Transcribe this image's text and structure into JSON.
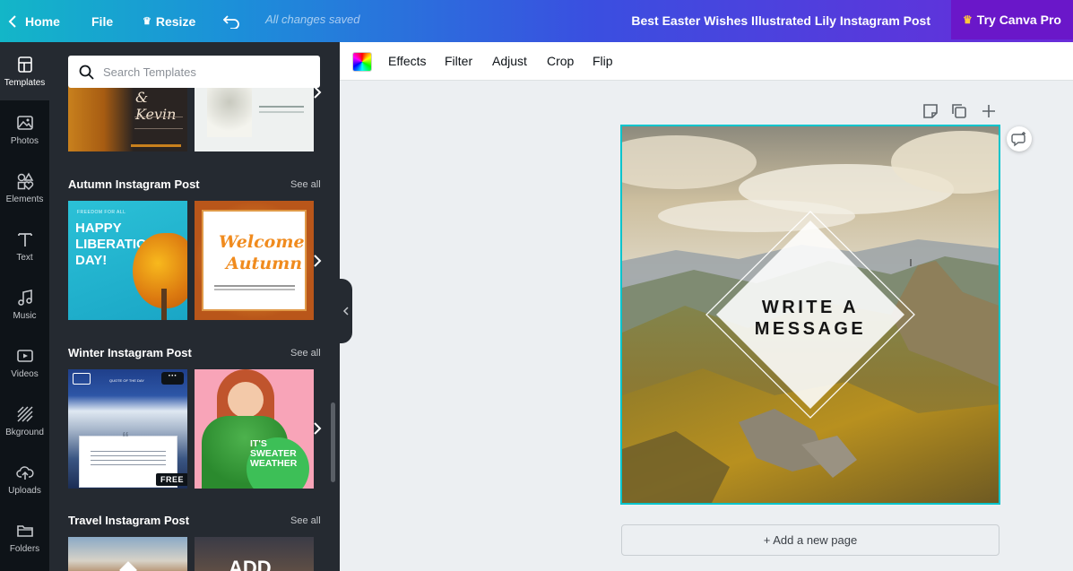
{
  "header": {
    "home_label": "Home",
    "file_label": "File",
    "resize_label": "Resize",
    "saved_status": "All changes saved",
    "doc_title": "Best Easter Wishes Illustrated Lily Instagram Post",
    "pro_label": "Try Canva Pro"
  },
  "rail": {
    "items": [
      {
        "label": "Templates",
        "icon": "templates-icon"
      },
      {
        "label": "Photos",
        "icon": "photos-icon"
      },
      {
        "label": "Elements",
        "icon": "elements-icon"
      },
      {
        "label": "Text",
        "icon": "text-icon"
      },
      {
        "label": "Music",
        "icon": "music-icon"
      },
      {
        "label": "Videos",
        "icon": "videos-icon"
      },
      {
        "label": "Bkground",
        "icon": "background-icon"
      },
      {
        "label": "Uploads",
        "icon": "uploads-icon"
      },
      {
        "label": "Folders",
        "icon": "folder-icon"
      }
    ]
  },
  "panel": {
    "search_placeholder": "Search Templates",
    "see_all": "See all",
    "sections": [
      {
        "title": "Autumn Instagram Post"
      },
      {
        "title": "Winter Instagram Post"
      },
      {
        "title": "Travel Instagram Post"
      }
    ],
    "thumbs": {
      "top_left_text": "& Kevin",
      "liberation": "HAPPY LIBERATION DAY!",
      "liberation_small": "FREEDOM FOR ALL",
      "autumn_line1": "Welcome",
      "autumn_line2": "Autumn",
      "winter_header": "QUOTE OF THE DAY",
      "free_badge": "FREE",
      "sweater": "IT'S SWEATER WEATHER",
      "travel_text": "ADD"
    }
  },
  "toolbar": {
    "effects": "Effects",
    "filter": "Filter",
    "adjust": "Adjust",
    "crop": "Crop",
    "flip": "Flip"
  },
  "canvas": {
    "line1": "WRITE A",
    "line2": "MESSAGE"
  },
  "add_page_label": "+ Add a new page",
  "colors": {
    "accent": "#00c4cc",
    "pro": "#6a17c9",
    "panel": "#252a31",
    "rail": "#0e1318"
  }
}
